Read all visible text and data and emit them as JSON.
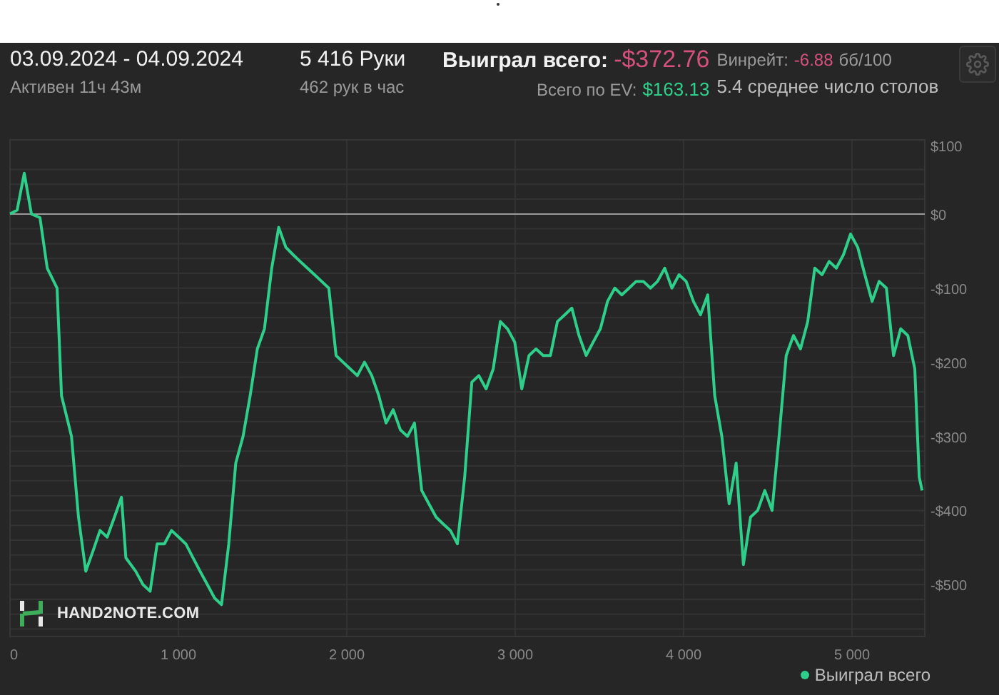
{
  "header": {
    "period": "03.09.2024 - 04.09.2024",
    "active": "Активен 11ч 43м",
    "hands": "5 416 Руки",
    "hands_per_hour": "462 рук в час",
    "won": {
      "label": "Выиграл всего:",
      "value": "-$372.76",
      "color": "#d6507c"
    },
    "winrate": {
      "label": "Винрейт:",
      "value": "-6.88",
      "color": "#d6507c",
      "unit": "бб/100"
    },
    "ev": {
      "label": "Всего по EV:",
      "value": "$163.13",
      "color": "#2ecf8a"
    },
    "avg_tables": "5.4 среднее число столов"
  },
  "chart": {
    "logo": "HAND2NOTE.COM",
    "chart_data": {
      "type": "line",
      "grid": true,
      "xlim": [
        0,
        5432
      ],
      "ylim": [
        -570,
        100
      ],
      "xticks": [
        {
          "value": 0,
          "label": "0"
        },
        {
          "value": 1000,
          "label": "1 000"
        },
        {
          "value": 2000,
          "label": "2 000"
        },
        {
          "value": 3000,
          "label": "3 000"
        },
        {
          "value": 4000,
          "label": "4 000"
        },
        {
          "value": 5000,
          "label": "5 000"
        }
      ],
      "yticks": [
        {
          "value": 100,
          "label": "$100"
        },
        {
          "value": 0,
          "label": "$0"
        },
        {
          "value": -100,
          "label": "-$100"
        },
        {
          "value": -200,
          "label": "-$200"
        },
        {
          "value": -300,
          "label": "-$300"
        },
        {
          "value": -400,
          "label": "-$400"
        },
        {
          "value": -500,
          "label": "-$500"
        }
      ],
      "x": [
        0,
        42,
        85,
        127,
        178,
        221,
        280,
        306,
        365,
        407,
        450,
        492,
        535,
        577,
        620,
        662,
        688,
        747,
        790,
        832,
        874,
        917,
        959,
        1002,
        1044,
        1087,
        1129,
        1172,
        1214,
        1256,
        1299,
        1341,
        1384,
        1426,
        1469,
        1511,
        1554,
        1596,
        1638,
        1681,
        1723,
        1766,
        1808,
        1851,
        1893,
        1936,
        1978,
        2020,
        2063,
        2105,
        2148,
        2190,
        2233,
        2275,
        2318,
        2360,
        2402,
        2445,
        2487,
        2530,
        2572,
        2615,
        2657,
        2700,
        2742,
        2784,
        2827,
        2869,
        2912,
        2954,
        2997,
        3039,
        3082,
        3124,
        3166,
        3209,
        3251,
        3294,
        3336,
        3379,
        3421,
        3463,
        3506,
        3548,
        3591,
        3633,
        3676,
        3718,
        3761,
        3803,
        3845,
        3888,
        3930,
        3973,
        4015,
        4058,
        4100,
        4143,
        4185,
        4227,
        4270,
        4312,
        4355,
        4397,
        4440,
        4482,
        4525,
        4567,
        4609,
        4652,
        4694,
        4737,
        4779,
        4822,
        4864,
        4907,
        4949,
        4991,
        5034,
        5076,
        5119,
        5161,
        5204,
        5246,
        5289,
        5331,
        5373,
        5399,
        5416
      ],
      "series": [
        {
          "name": "Выиграл всего",
          "color": "#2ecf8a",
          "values": [
            0,
            5,
            55,
            0,
            -5,
            -73,
            -100,
            -245,
            -300,
            -409,
            -482,
            -455,
            -427,
            -436,
            -409,
            -382,
            -464,
            -482,
            -500,
            -509,
            -445,
            -445,
            -427,
            -436,
            -445,
            -464,
            -482,
            -500,
            -518,
            -527,
            -445,
            -336,
            -300,
            -245,
            -182,
            -155,
            -73,
            -18,
            -45,
            -55,
            -64,
            -73,
            -82,
            -91,
            -100,
            -191,
            -200,
            -209,
            -218,
            -200,
            -218,
            -245,
            -282,
            -264,
            -291,
            -300,
            -282,
            -373,
            -391,
            -409,
            -418,
            -427,
            -445,
            -355,
            -227,
            -218,
            -236,
            -209,
            -145,
            -155,
            -173,
            -236,
            -191,
            -182,
            -191,
            -191,
            -145,
            -136,
            -127,
            -164,
            -191,
            -173,
            -155,
            -118,
            -100,
            -109,
            -100,
            -91,
            -91,
            -100,
            -91,
            -73,
            -100,
            -82,
            -91,
            -118,
            -136,
            -109,
            -245,
            -300,
            -391,
            -336,
            -473,
            -409,
            -400,
            -373,
            -400,
            -300,
            -191,
            -164,
            -182,
            -145,
            -73,
            -82,
            -64,
            -73,
            -55,
            -27,
            -45,
            -82,
            -118,
            -91,
            -100,
            -191,
            -155,
            -164,
            -209,
            -355,
            -373
          ]
        }
      ]
    }
  }
}
